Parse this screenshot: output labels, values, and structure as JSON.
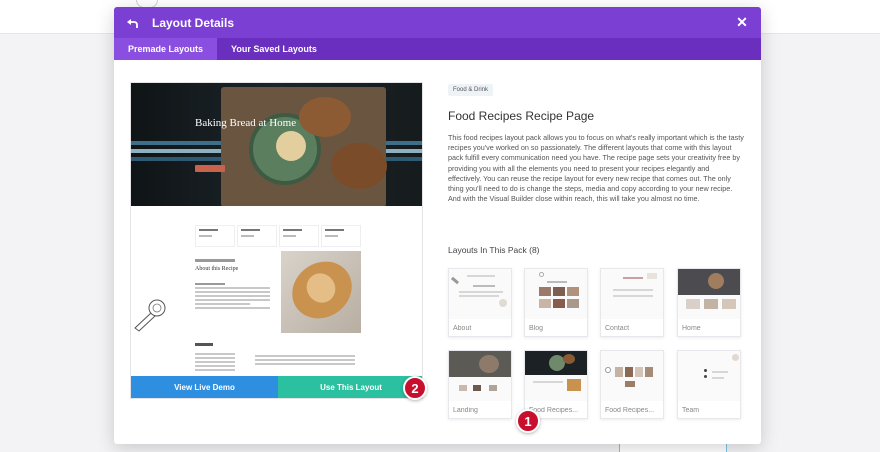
{
  "modal": {
    "title": "Layout Details",
    "close_symbol": "✕",
    "back_icon": "back-arrow-icon"
  },
  "tabs": [
    {
      "label": "Premade Layouts",
      "active": true
    },
    {
      "label": "Your Saved Layouts",
      "active": false
    }
  ],
  "preview": {
    "hero_title": "Baking Bread at Home",
    "intro_title": "About this Recipe",
    "view_demo_label": "View Live Demo",
    "use_layout_label": "Use This Layout"
  },
  "details": {
    "category": "Food & Drink",
    "title": "Food Recipes Recipe Page",
    "description": "This food recipes layout pack allows you to focus on what's really important which is the tasty recipes you've worked on so passionately. The different layouts that come with this layout pack fulfill every communication need you have. The recipe page sets your creativity free by providing you with all the elements you need to present your recipes elegantly and effectively. You can reuse the recipe layout for every new recipe that comes out. The only thing you'll need to do is change the steps, media and copy according to your new recipe. And with the Visual Builder close within reach, this will take you almost no time.",
    "layouts_heading": "Layouts In This Pack (8)"
  },
  "layouts": [
    {
      "label": "About"
    },
    {
      "label": "Blog"
    },
    {
      "label": "Contact"
    },
    {
      "label": "Home"
    },
    {
      "label": "Landing"
    },
    {
      "label": "Food Recipes..."
    },
    {
      "label": "Food Recipes..."
    },
    {
      "label": "Team"
    }
  ],
  "markers": [
    {
      "number": "2"
    },
    {
      "number": "1"
    }
  ],
  "colors": {
    "header": "#7b3fd4",
    "tabs": "#6a2fbf",
    "demo_button": "#2e8fe0",
    "use_button": "#2bc09f",
    "marker": "#c8102e"
  }
}
